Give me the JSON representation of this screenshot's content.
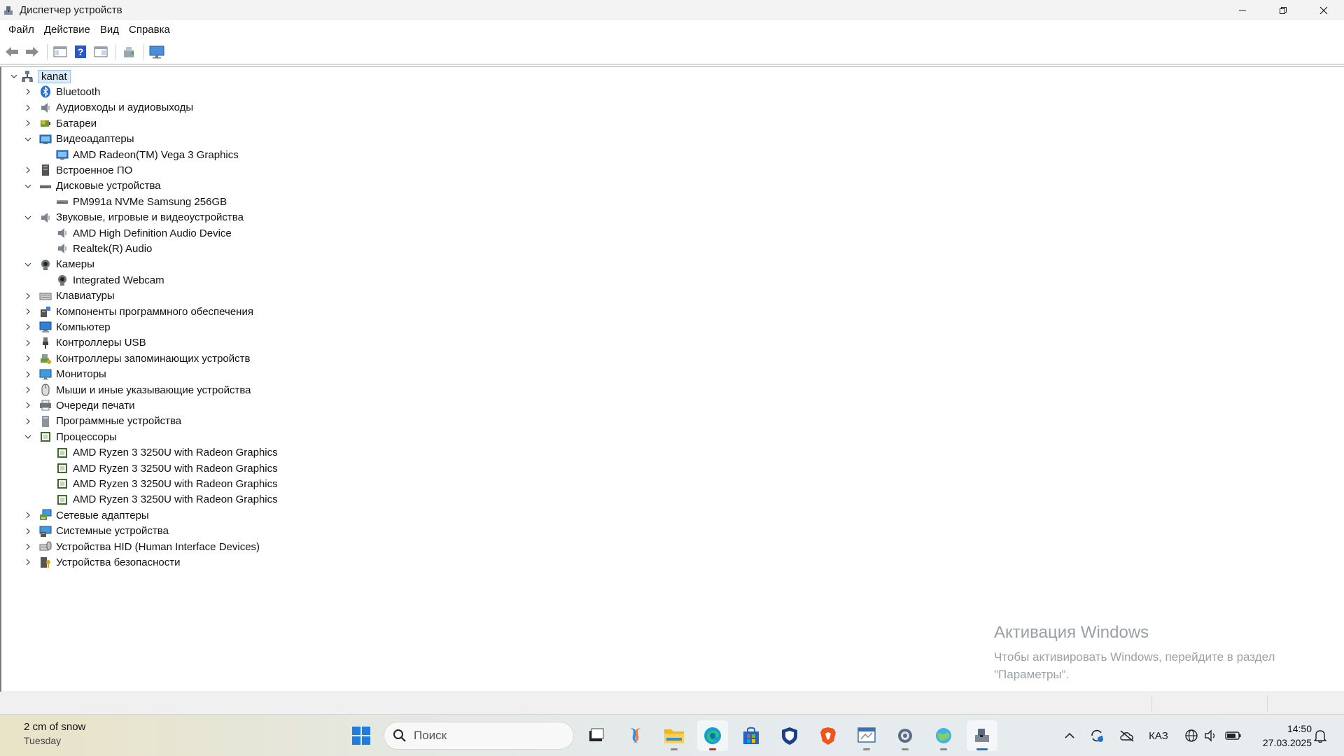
{
  "window": {
    "title": "Диспетчер устройств"
  },
  "menu": [
    "Файл",
    "Действие",
    "Вид",
    "Справка"
  ],
  "tree": {
    "root": "kanat",
    "items": [
      {
        "label": "Bluetooth",
        "level": 1,
        "expanded": false,
        "icon": "bluetooth-icon"
      },
      {
        "label": "Аудиовходы и аудиовыходы",
        "level": 1,
        "expanded": false,
        "icon": "speaker-icon"
      },
      {
        "label": "Батареи",
        "level": 1,
        "expanded": false,
        "icon": "battery-icon"
      },
      {
        "label": "Видеоадаптеры",
        "level": 1,
        "expanded": true,
        "icon": "display-adapter-icon"
      },
      {
        "label": "AMD Radeon(TM) Vega 3 Graphics",
        "level": 2,
        "icon": "display-adapter-icon"
      },
      {
        "label": "Встроенное ПО",
        "level": 1,
        "expanded": false,
        "icon": "firmware-icon"
      },
      {
        "label": "Дисковые устройства",
        "level": 1,
        "expanded": true,
        "icon": "disk-icon"
      },
      {
        "label": "PM991a NVMe Samsung 256GB",
        "level": 2,
        "icon": "disk-icon"
      },
      {
        "label": "Звуковые, игровые и видеоустройства",
        "level": 1,
        "expanded": true,
        "icon": "speaker-icon"
      },
      {
        "label": "AMD High Definition Audio Device",
        "level": 2,
        "icon": "speaker-icon"
      },
      {
        "label": "Realtek(R) Audio",
        "level": 2,
        "icon": "speaker-icon"
      },
      {
        "label": "Камеры",
        "level": 1,
        "expanded": true,
        "icon": "camera-icon"
      },
      {
        "label": "Integrated Webcam",
        "level": 2,
        "icon": "camera-icon"
      },
      {
        "label": "Клавиатуры",
        "level": 1,
        "expanded": false,
        "icon": "keyboard-icon"
      },
      {
        "label": "Компоненты программного обеспечения",
        "level": 1,
        "expanded": false,
        "icon": "software-component-icon"
      },
      {
        "label": "Компьютер",
        "level": 1,
        "expanded": false,
        "icon": "computer-icon"
      },
      {
        "label": "Контроллеры USB",
        "level": 1,
        "expanded": false,
        "icon": "usb-icon"
      },
      {
        "label": "Контроллеры запоминающих устройств",
        "level": 1,
        "expanded": false,
        "icon": "storage-controller-icon"
      },
      {
        "label": "Мониторы",
        "level": 1,
        "expanded": false,
        "icon": "monitor-icon"
      },
      {
        "label": "Мыши и иные указывающие устройства",
        "level": 1,
        "expanded": false,
        "icon": "mouse-icon"
      },
      {
        "label": "Очереди печати",
        "level": 1,
        "expanded": false,
        "icon": "printer-icon"
      },
      {
        "label": "Программные устройства",
        "level": 1,
        "expanded": false,
        "icon": "software-device-icon"
      },
      {
        "label": "Процессоры",
        "level": 1,
        "expanded": true,
        "icon": "processor-icon"
      },
      {
        "label": "AMD Ryzen 3 3250U with Radeon Graphics",
        "level": 2,
        "icon": "processor-icon"
      },
      {
        "label": "AMD Ryzen 3 3250U with Radeon Graphics",
        "level": 2,
        "icon": "processor-icon"
      },
      {
        "label": "AMD Ryzen 3 3250U with Radeon Graphics",
        "level": 2,
        "icon": "processor-icon"
      },
      {
        "label": "AMD Ryzen 3 3250U with Radeon Graphics",
        "level": 2,
        "icon": "processor-icon"
      },
      {
        "label": "Сетевые адаптеры",
        "level": 1,
        "expanded": false,
        "icon": "network-adapter-icon"
      },
      {
        "label": "Системные устройства",
        "level": 1,
        "expanded": false,
        "icon": "system-device-icon"
      },
      {
        "label": "Устройства HID (Human Interface Devices)",
        "level": 1,
        "expanded": false,
        "icon": "hid-icon"
      },
      {
        "label": "Устройства безопасности",
        "level": 1,
        "expanded": false,
        "icon": "security-device-icon"
      }
    ]
  },
  "watermark": {
    "title": "Активация Windows",
    "line1": "Чтобы активировать Windows, перейдите в раздел",
    "line2": "\"Параметры\"."
  },
  "taskbar": {
    "weather_line1": "2 cm of snow",
    "weather_line2": "Tuesday",
    "search_placeholder": "Поиск",
    "language": "КАЗ",
    "time": "14:50",
    "date": "27.03.2025"
  }
}
